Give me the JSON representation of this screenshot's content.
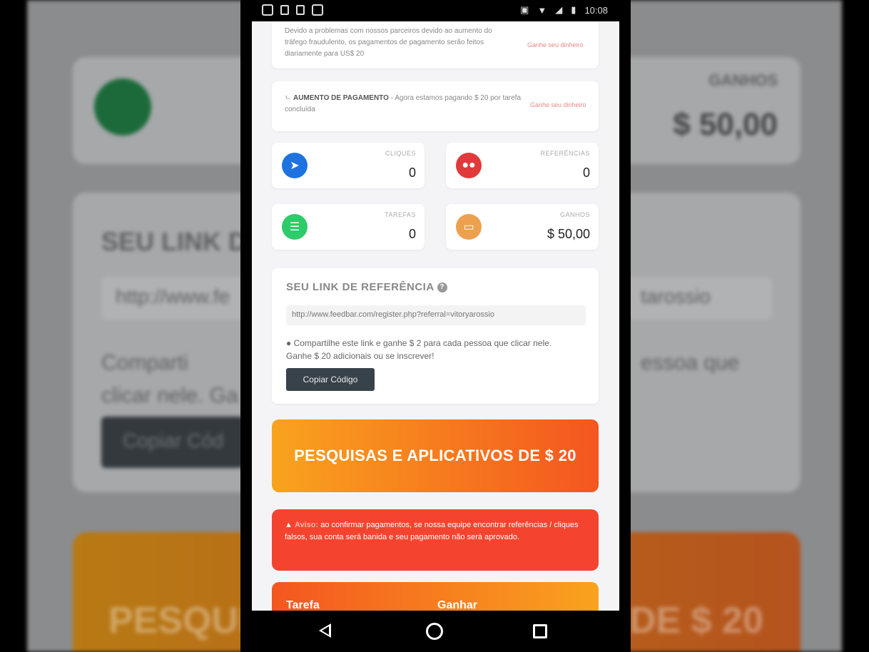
{
  "status_bar": {
    "time": "10:08"
  },
  "notices": {
    "payment_problem": "Devido a problemas com nossos parceiros devido ao aumento do tráfego fraudulento, os pagamentos de pagamento serão feitos diariamente para US$ 20",
    "payment_problem_link": "Ganhe seu dinheiro",
    "increase_title": "AUMENTO DE PAGAMENTO",
    "increase_text": "- Agora estamos pagando $ 20 por tarefa concluída",
    "increase_link": "Ganhe seu dinheiro"
  },
  "stats": [
    {
      "label": "CLIQUES",
      "value": "0",
      "icon": "cursor-icon",
      "color": "#1f73e0"
    },
    {
      "label": "REFERÊNCIAS",
      "value": "0",
      "icon": "users-icon",
      "color": "#e03a3a"
    },
    {
      "label": "TAREFAS",
      "value": "0",
      "icon": "list-icon",
      "color": "#2ecb6b"
    },
    {
      "label": "GANHOS",
      "value": "$ 50,00",
      "icon": "money-icon",
      "color": "#eda04e"
    }
  ],
  "referral": {
    "title": "SEU LINK DE REFERÊNCIA",
    "url": "http://www.feedbar.com/register.php?referral=vitoryarossio",
    "description": "Compartilhe este link e ganhe $ 2 para cada pessoa que clicar nele. Ganhe $ 20 adicionais ou se inscrever!",
    "button": "Copiar Código"
  },
  "promo": {
    "text": "PESQUISAS E APLICATIVOS DE $ 20"
  },
  "warning": {
    "label": "Aviso:",
    "text": "ao confirmar pagamentos, se nossa equipe encontrar referências / cliques falsos, sua conta será banida e seu pagamento não será aprovado."
  },
  "task_table": {
    "col1": "Tarefa",
    "col2": "Ganhar"
  },
  "background": {
    "earnings_label": "GANHOS",
    "earnings_value": "$ 50,00",
    "link_title": "SEU LINK D",
    "url_left": "http://www.fe",
    "url_right": "tarossio",
    "desc_left": "Comparti",
    "desc_left2": "clicar nele. Ga",
    "desc_right": "essoa que",
    "button": "Copiar Cód",
    "promo_left": "PESQUI",
    "promo_right": "DE $ 20"
  },
  "colors": {
    "promo_start": "#f9a31e",
    "promo_end": "#f4561f",
    "warning": "#f4442f",
    "button": "#38424a"
  }
}
